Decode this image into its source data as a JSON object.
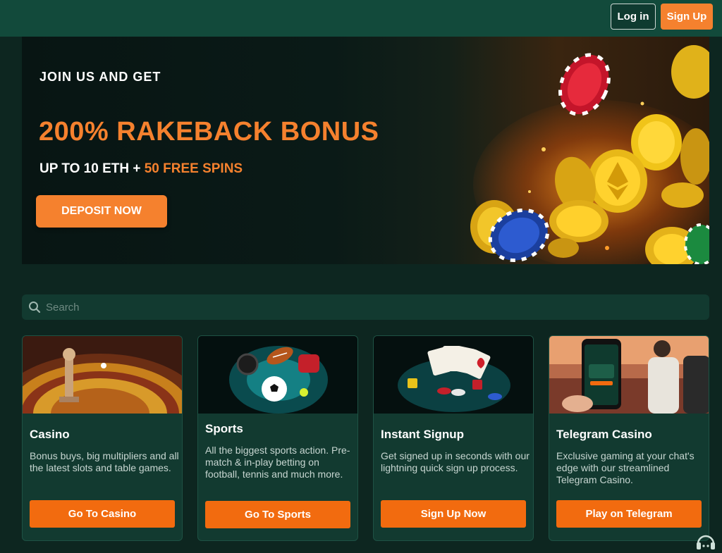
{
  "header": {
    "login_label": "Log in",
    "signup_label": "Sign Up"
  },
  "hero": {
    "eyebrow": "JOIN US AND GET",
    "title": "200% RAKEBACK BONUS",
    "subtitle_prefix": "UP TO 10 ETH + ",
    "subtitle_accent": "50 FREE SPINS",
    "cta_label": "DEPOSIT NOW"
  },
  "search": {
    "placeholder": "Search"
  },
  "cards": [
    {
      "title": "Casino",
      "description": "Bonus buys, big multipliers and all the latest slots and table games.",
      "button": "Go To Casino"
    },
    {
      "title": "Sports",
      "description": "All the biggest sports action. Pre-match & in-play betting on football, tennis and much more.",
      "button": "Go To Sports"
    },
    {
      "title": "Instant Signup",
      "description": "Get signed up in seconds with our lightning quick sign up process.",
      "button": "Sign Up Now"
    },
    {
      "title": "Telegram Casino",
      "description": "Exclusive gaming at your chat's edge with our streamlined Telegram Casino.",
      "button": "Play on Telegram"
    }
  ],
  "colors": {
    "accent": "#f5812e",
    "button_orange": "#f26b0f",
    "background": "#0d2620",
    "header": "#124a3b",
    "card": "#123a30"
  },
  "icons": {
    "search": "search-icon",
    "support": "support-headset-icon"
  }
}
